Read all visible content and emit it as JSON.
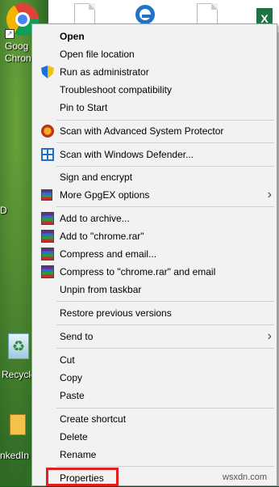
{
  "desktop": {
    "chrome_label_1": "Goog",
    "chrome_label_2": "Chron",
    "left_char": "D",
    "recycle_label": "Recycle",
    "linked_label": "nkedIn"
  },
  "context_menu": {
    "items": [
      {
        "label": "Open",
        "bold": true
      },
      {
        "label": "Open file location"
      },
      {
        "label": "Run as administrator",
        "icon": "uac-shield-icon"
      },
      {
        "label": "Troubleshoot compatibility"
      },
      {
        "label": "Pin to Start"
      },
      {
        "label": "Scan with Advanced System Protector",
        "icon": "advanced-system-protector-icon"
      },
      {
        "label": "Scan with Windows Defender...",
        "icon": "windows-defender-icon"
      },
      {
        "label": "Sign and encrypt"
      },
      {
        "label": "More GpgEX options",
        "icon": "gpgex-icon",
        "submenu": true
      },
      {
        "label": "Add to archive...",
        "icon": "winrar-icon"
      },
      {
        "label": "Add to \"chrome.rar\"",
        "icon": "winrar-icon"
      },
      {
        "label": "Compress and email...",
        "icon": "winrar-icon"
      },
      {
        "label": "Compress to \"chrome.rar\" and email",
        "icon": "winrar-icon"
      },
      {
        "label": "Unpin from taskbar"
      },
      {
        "label": "Restore previous versions"
      },
      {
        "label": "Send to",
        "submenu": true
      },
      {
        "label": "Cut"
      },
      {
        "label": "Copy"
      },
      {
        "label": "Paste"
      },
      {
        "label": "Create shortcut"
      },
      {
        "label": "Delete"
      },
      {
        "label": "Rename"
      },
      {
        "label": "Properties",
        "highlighted": true
      }
    ]
  },
  "highlight_color": "#e02020",
  "watermark": "wsxdn.com"
}
